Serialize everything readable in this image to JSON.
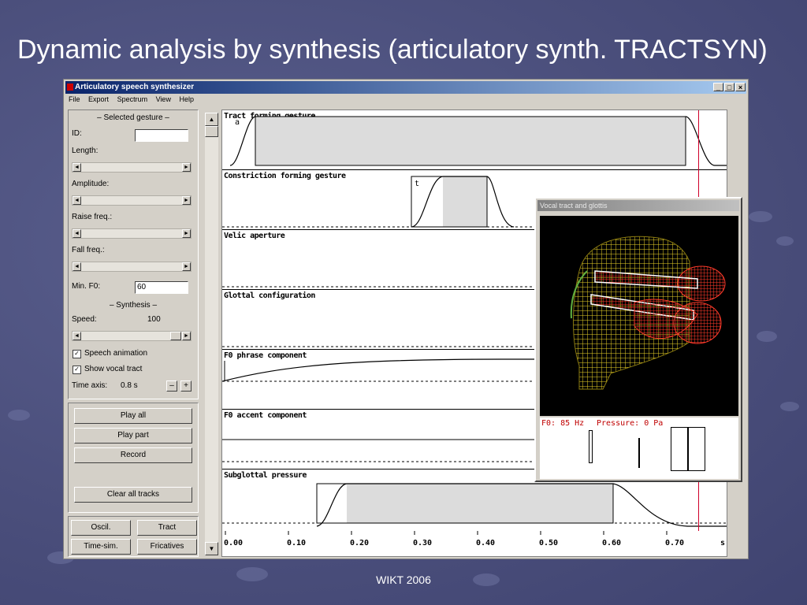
{
  "slide": {
    "title": "Dynamic analysis by synthesis (articulatory synth. TRACTSYN)",
    "footer": "WIKT 2006"
  },
  "window": {
    "title": "Articulatory speech synthesizer",
    "minimize": "_",
    "maximize": "□",
    "close": "×"
  },
  "menu": [
    "File",
    "Export",
    "Spectrum",
    "View",
    "Help"
  ],
  "gesture_panel": {
    "header": "– Selected gesture –",
    "id_label": "ID:",
    "id_value": "",
    "length_label": "Length:",
    "amplitude_label": "Amplitude:",
    "raise_label": "Raise freq.:",
    "fall_label": "Fall freq.:",
    "minf0_label": "Min. F0:",
    "minf0_value": "60"
  },
  "synthesis_panel": {
    "header": "– Synthesis –",
    "speed_label": "Speed:",
    "speed_value": "100",
    "speech_animation_label": "Speech animation",
    "speech_animation_checked": true,
    "show_vocal_tract_label": "Show vocal tract",
    "show_vocal_tract_checked": true,
    "time_axis_label": "Time axis:",
    "time_axis_value": "0.8 s",
    "minus": "–",
    "plus": "+"
  },
  "buttons": {
    "play_all": "Play all",
    "play_part": "Play part",
    "record": "Record",
    "clear_all": "Clear all tracks",
    "oscil": "Oscil.",
    "tract": "Tract",
    "time_sim": "Time-sim.",
    "fricatives": "Fricatives"
  },
  "tracks": [
    "Tract forming gesture",
    "Constriction forming gesture",
    "Velic aperture",
    "Glottal configuration",
    "F0 phrase component",
    "F0 accent component",
    "Subglottal pressure"
  ],
  "gesture_tags": {
    "tract": "a",
    "constriction": "t"
  },
  "time_axis": {
    "ticks": [
      "0.00",
      "0.10",
      "0.20",
      "0.30",
      "0.40",
      "0.50",
      "0.60",
      "0.70"
    ],
    "unit": "s",
    "cursor_time_s": 0.75
  },
  "vocal_tract_window": {
    "title": "Vocal tract and glottis",
    "f0_text": "F0: 85 Hz",
    "pressure_text": "Pressure: 0 Pa"
  },
  "colors": {
    "title_bar": "#0a246a",
    "cursor": "#d0002a",
    "info_text": "#c00000",
    "tract_mesh": "#e8d028",
    "lip_mesh": "#ff3a2a"
  },
  "icons": {
    "scroll_up": "▲",
    "scroll_down": "▼",
    "left": "◄",
    "right": "►",
    "check": "✓"
  }
}
